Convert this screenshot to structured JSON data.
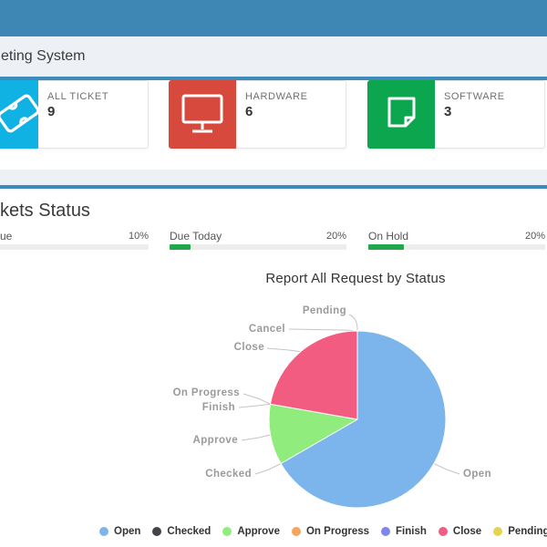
{
  "topbar": {
    "color": "#3e87b5"
  },
  "header": {
    "title": "eting System"
  },
  "cards": [
    {
      "label": "ALL TICKET",
      "value": "9",
      "icon": "ticket-icon",
      "box_color": "#10b2e4"
    },
    {
      "label": "HARDWARE",
      "value": "6",
      "icon": "monitor-icon",
      "box_color": "#d6493c"
    },
    {
      "label": "SOFTWARE",
      "value": "3",
      "icon": "document-icon",
      "box_color": "#0ca64f"
    }
  ],
  "status": {
    "heading": "kets Status",
    "bar_color": "#23a74b",
    "items": [
      {
        "label": "ue",
        "percent": "10%",
        "fill_width": "10%"
      },
      {
        "label": "Due Today",
        "percent": "20%",
        "fill_width": "12%"
      },
      {
        "label": "On Hold",
        "percent": "20%",
        "fill_width": "20%"
      }
    ]
  },
  "chart_data": {
    "type": "pie",
    "title": "Report All Request by Status",
    "legend_position": "bottom",
    "points": [
      {
        "label": "Open",
        "value": 6,
        "color": "#7cb5ec"
      },
      {
        "label": "Checked",
        "value": 0,
        "color": "#434348"
      },
      {
        "label": "Approve",
        "value": 1,
        "color": "#90ed7d"
      },
      {
        "label": "On Progress",
        "value": 0,
        "color": "#f7a35c"
      },
      {
        "label": "Finish",
        "value": 0,
        "color": "#8085e9"
      },
      {
        "label": "Close",
        "value": 2,
        "color": "#f15c80"
      },
      {
        "label": "Pending",
        "value": 0,
        "color": "#e4d354"
      },
      {
        "label": "Cancel",
        "value": 0,
        "color": "#2b908f"
      }
    ]
  }
}
